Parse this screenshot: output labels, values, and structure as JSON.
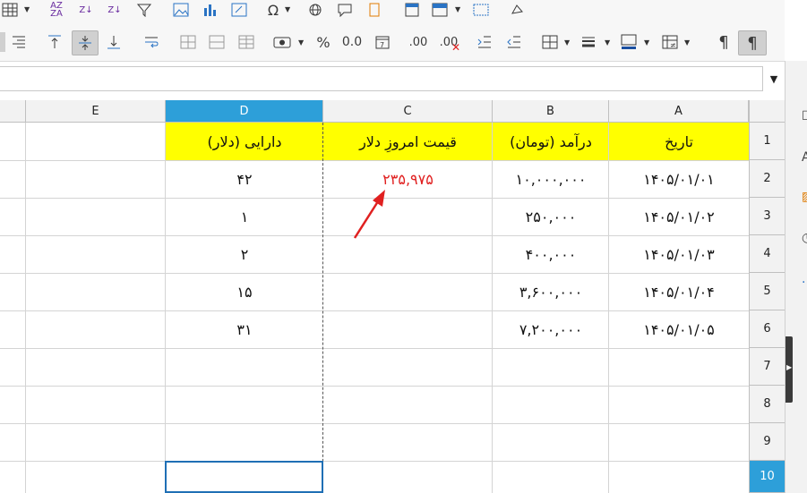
{
  "toolbar": {
    "row1_icons": [
      "table-icon",
      "sort-ascending-icon",
      "sort-descending-icon",
      "sort-icon",
      "autofilter-icon",
      "image-icon",
      "chart-icon",
      "pivot-table-icon",
      "special-character-icon",
      "hyperlink-icon",
      "comment-icon",
      "headers-footers-icon",
      "print-area-icon",
      "freeze-rows-icon",
      "split-window-icon",
      "shapes-icon"
    ],
    "row2_icons": [
      "align-right-icon",
      "align-top-icon",
      "center-vertically-icon",
      "align-bottom-icon",
      "wrap-text-icon",
      "merge-cells-icon",
      "merge-center-icon",
      "unmerge-cells-icon",
      "currency-format-icon",
      "percent-format-icon",
      "number-format-icon",
      "date-format-icon",
      "add-decimal-icon",
      "delete-decimal-icon",
      "increase-indent-icon",
      "decrease-indent-icon",
      "borders-icon",
      "border-style-icon",
      "border-color-icon",
      "conditional-format-icon",
      "ltr-icon",
      "rtl-icon"
    ],
    "percent_glyph": "%",
    "number_glyph": "0.0",
    "add_decimal_glyph": ".00",
    "delete_decimal_glyph": ".00",
    "special_char_glyph": "Ω",
    "ltr_glyph": "¶",
    "rtl_glyph": "¶"
  },
  "formula_bar": {
    "value": ""
  },
  "columns": [
    "A",
    "B",
    "C",
    "D",
    "E"
  ],
  "selected_column": "D",
  "rows": [
    "1",
    "2",
    "3",
    "4",
    "5",
    "6",
    "7",
    "8",
    "9",
    "10"
  ],
  "selected_row": "10",
  "cells": {
    "A1": "تاریخ",
    "B1": "درآمد (تومان)",
    "C1": "قیمت امروزِ دلار",
    "D1": "دارایی (دلار)",
    "A2": "۱۴۰۵/۰۱/۰۱",
    "A3": "۱۴۰۵/۰۱/۰۲",
    "A4": "۱۴۰۵/۰۱/۰۳",
    "A5": "۱۴۰۵/۰۱/۰۴",
    "A6": "۱۴۰۵/۰۱/۰۵",
    "B2": "۱۰,۰۰۰,۰۰۰",
    "B3": "۲۵۰,۰۰۰",
    "B4": "۴۰۰,۰۰۰",
    "B5": "۳,۶۰۰,۰۰۰",
    "B6": "۷,۲۰۰,۰۰۰",
    "C2": "۲۳۵,۹۷۵",
    "D2": "۴۲",
    "D3": "۱",
    "D4": "۲",
    "D5": "۱۵",
    "D6": "۳۱"
  },
  "colors": {
    "header_fill": "#ffff00",
    "highlight_text": "#e02020",
    "selection": "#2d9fd9",
    "annotation_arrow": "#e02020"
  },
  "sidebar": {
    "icons": [
      "properties-icon",
      "styles-icon",
      "gallery-icon",
      "navigator-icon",
      "functions-icon"
    ]
  }
}
